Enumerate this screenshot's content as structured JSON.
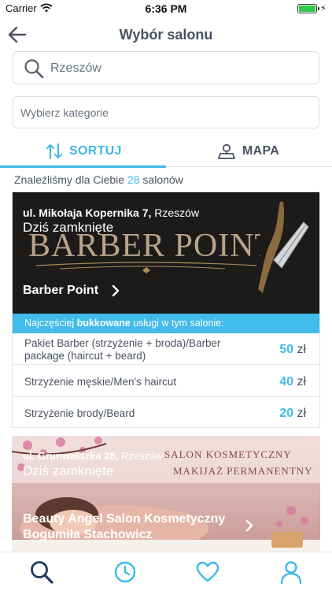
{
  "status_bar": {
    "carrier": "Carrier",
    "time": "6:36 PM",
    "wifi_icon": "wifi-icon",
    "battery_icon": "battery-icon"
  },
  "nav": {
    "title": "Wybór salonu",
    "back_icon": "arrow-left-icon"
  },
  "search": {
    "value": "Rzeszów",
    "icon": "search-icon"
  },
  "category": {
    "placeholder": "Wybierz kategorie"
  },
  "tabs": [
    {
      "label": "SORTUJ",
      "icon": "sort-arrows-icon",
      "active": true
    },
    {
      "label": "MAPA",
      "icon": "map-pin-icon",
      "active": false
    }
  ],
  "results": {
    "prefix": "Znaleźliśmy dla Ciebie",
    "count": "28",
    "suffix": "salonów"
  },
  "salons": [
    {
      "street": "ul. Mikołaja Kopernika 7,",
      "city": "Rzeszów",
      "status": "Dziś zamknięte",
      "logo_text": "BARBER POINT",
      "name": "Barber Point",
      "services_header_prefix": "Najczęściej",
      "services_header_bold": "bukkowane",
      "services_header_suffix": "usługi w tym salonie:",
      "services": [
        {
          "name_line1": "Pakiet Barber (strzyżenie + broda)/Barber",
          "name_line2": "package (haircut + beard)",
          "price": "50",
          "currency": "zł"
        },
        {
          "name_line1": "Strzyżenie męskie/Men's haircut",
          "name_line2": "",
          "price": "40",
          "currency": "zł"
        },
        {
          "name_line1": "Strzyżenie brody/Beard",
          "name_line2": "",
          "price": "20",
          "currency": "zł"
        }
      ]
    },
    {
      "street": "ul. Grunwaldzka 28,",
      "city": "Rzeszów",
      "status": "Dziś zamknięte",
      "sign_line1": "SALON KOSMETYCZNY",
      "sign_line2": "MAKIJAŻ PERMANENTNY",
      "name": "Beauty Angel Salon Kosmetyczny Bogumiła Stachowicz"
    }
  ],
  "tabbar": [
    {
      "icon": "search-icon",
      "active": true
    },
    {
      "icon": "clock-icon",
      "active": false
    },
    {
      "icon": "heart-icon",
      "active": false
    },
    {
      "icon": "user-icon",
      "active": false
    }
  ],
  "colors": {
    "accent": "#3fb8e8",
    "text": "#4a5262",
    "dark_nav": "#1f3a5f"
  }
}
